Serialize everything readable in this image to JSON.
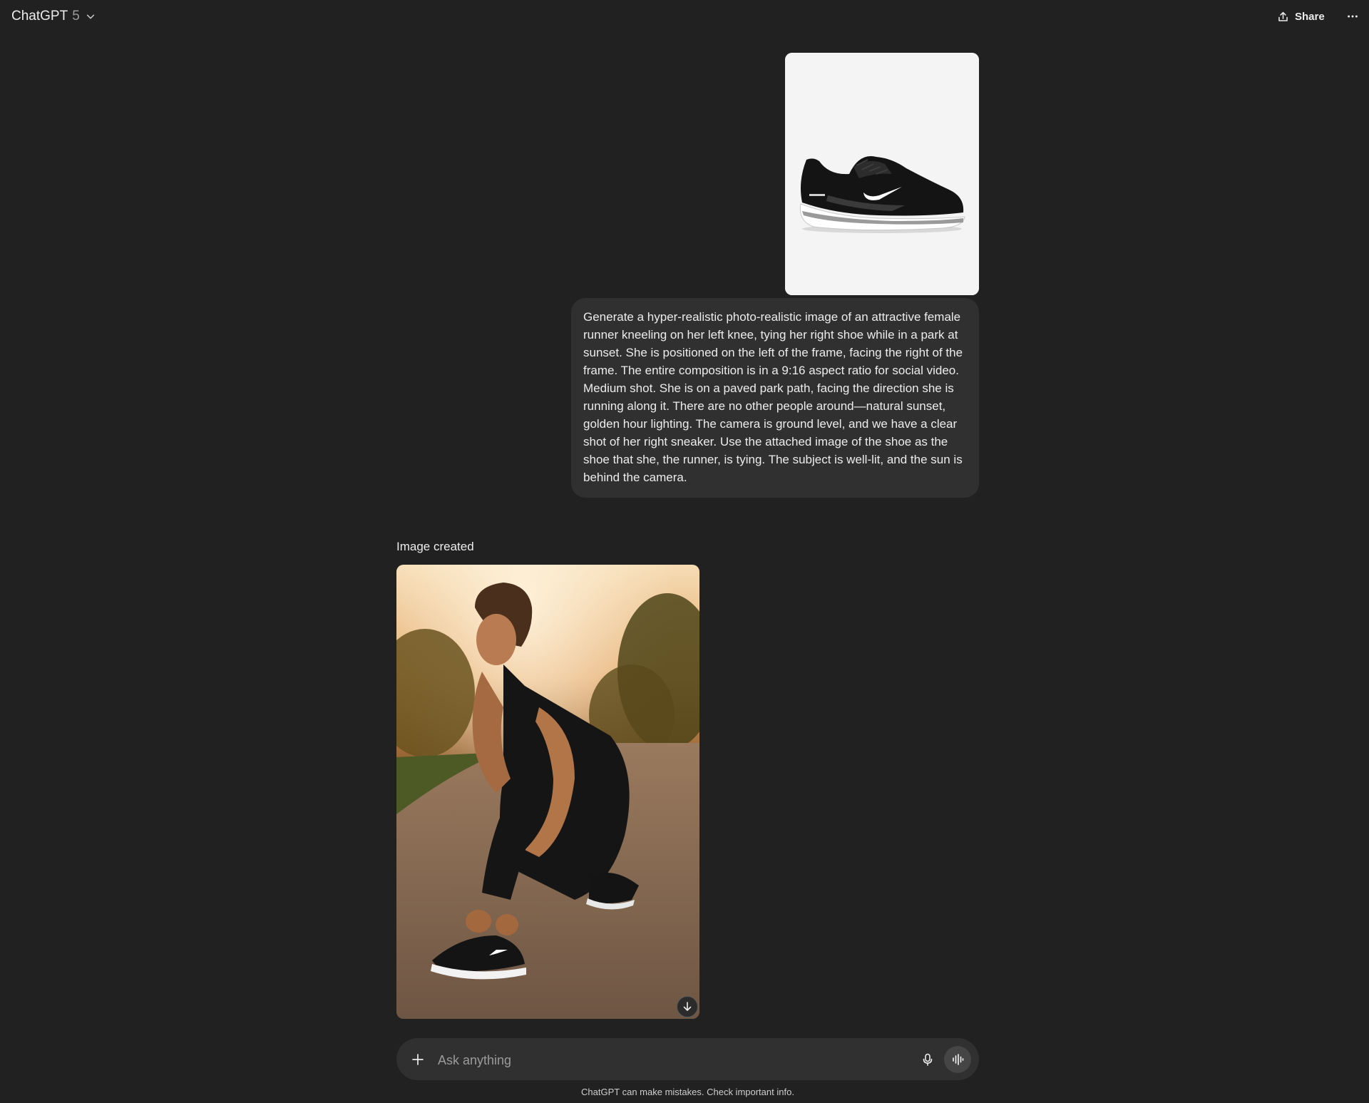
{
  "header": {
    "model_name": "ChatGPT",
    "model_version": "5",
    "share_label": "Share"
  },
  "conversation": {
    "user_message": {
      "attachment_icon": "running-shoe-image",
      "text": "Generate a hyper-realistic photo-realistic image of an attractive female runner kneeling on her left knee, tying her right shoe while in a park at sunset. She is positioned on the left of the frame, facing the right of the frame. The entire composition is in a 9:16 aspect ratio for social video. Medium shot. She is on a paved park path, facing the direction she is running along it. There are no other people around—natural sunset, golden hour lighting. The camera is ground level, and we have a clear shot of her right sneaker. Use the attached image of the shoe as the shoe that she, the runner, is tying. The subject is well-lit, and the sun is behind the camera."
    },
    "assistant_message": {
      "status_label": "Image created",
      "image_icon": "generated-runner-image"
    }
  },
  "composer": {
    "placeholder": "Ask anything"
  },
  "footer": {
    "disclaimer": "ChatGPT can make mistakes. Check important info."
  },
  "colors": {
    "background": "#212121",
    "bubble": "#303030",
    "text": "#ececec",
    "muted": "#9b9b9b"
  }
}
